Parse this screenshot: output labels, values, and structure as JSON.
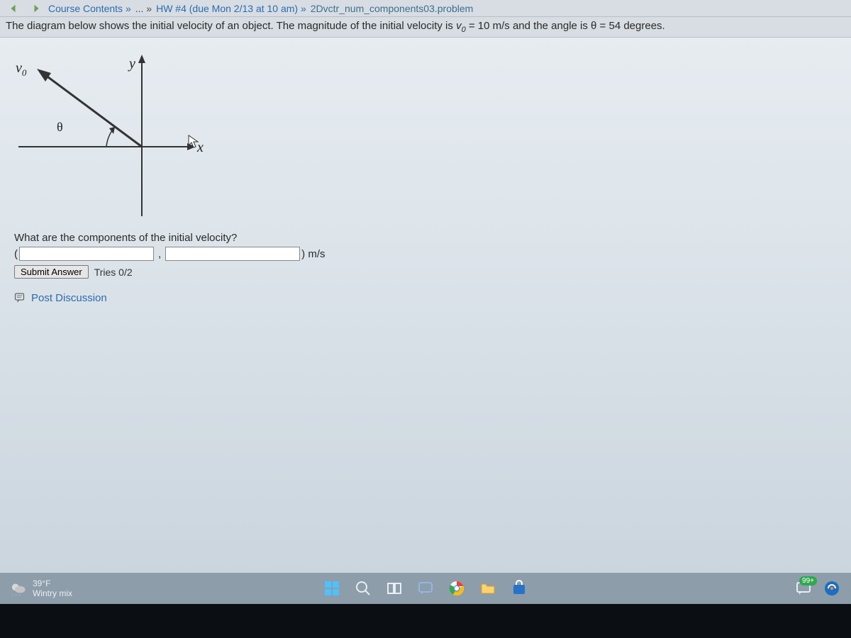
{
  "breadcrumb": {
    "course_contents": "Course Contents »",
    "ellipsis": "... »",
    "hw": "HW #4 (due Mon 2/13 at 10 am) »",
    "current": "2Dvctr_num_components03.problem"
  },
  "problem": {
    "text_before_v0": "The diagram below shows the initial velocity of an object. The magnitude of the initial velocity is ",
    "v0_symbol": "v",
    "v0_sub": "0",
    "text_mid": " = 10 m/s and the angle is θ = 54 degrees."
  },
  "figure": {
    "y": "y",
    "x": "x",
    "v0": "v",
    "v0_sub": "0",
    "theta": "θ"
  },
  "question": "What are the components of the initial velocity?",
  "answer": {
    "open_paren": "(",
    "comma": ",",
    "close_paren_unit": ") m/s"
  },
  "submit": {
    "button": "Submit Answer",
    "tries": "Tries 0/2"
  },
  "post": "Post Discussion",
  "taskbar": {
    "temp": "39°F",
    "cond": "Wintry mix",
    "badge": "99+"
  }
}
